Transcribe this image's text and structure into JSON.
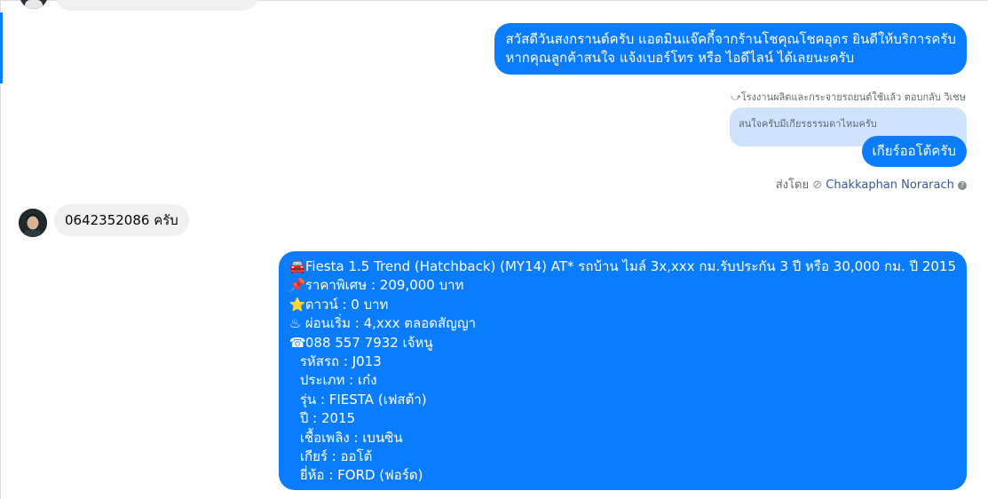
{
  "messages": {
    "top_outgoing": {
      "lines": [
        "สวัสดีวันสงกรานต์ครับ แอดมินแจ๊คกี้จากร้านโชคุณโชคอุดร ยินดีให้บริการครับ",
        "หากคุณลูกค้าสนใจ แจ้งเบอร์โทร หรือ ไอดีไลน์ ได้เลยนะครับ"
      ]
    },
    "reply_context": {
      "label": "โรงงานผลิตและกระจายรถยนต์ใช้แล้ว ตอบกลับ วิเชษ",
      "quoted_text": "สนใจครับมีเกียรธรรมดาไหมครับ"
    },
    "gear_reply": "เกียร์ออโต้ครับ",
    "sent_by": {
      "prefix": "ส่งโดย",
      "name": "Chakkaphan Norarach",
      "help": "?"
    },
    "incoming_phone": "0642352086  ครับ",
    "listing": {
      "lines": [
        {
          "icon": "🚘",
          "text": "Fiesta 1.5 Trend (Hatchback) (MY14) AT* รถบ้าน ไมล์ 3x,xxx กม.รับประกัน 3 ปี หรือ 30,000 กม. ปี 2015"
        },
        {
          "icon": "📌",
          "text": "ราคาพิเศษ : 209,000 บาท"
        },
        {
          "icon": "⭐",
          "text": "ดาวน์ : 0 บาท"
        },
        {
          "icon": "♨",
          "text": "ผ่อนเริ่ม : 4,xxx ตลอดสัญญา"
        },
        {
          "icon": "☎",
          "text": "088 557 7932 เจ้หนู"
        }
      ],
      "details": [
        "รหัสรถ : J013",
        "ประเภท : เก๋ง",
        "รุ่น : FIESTA (เฟสต้า)",
        "ปี : 2015",
        "เชื้อเพลิง : เบนซิน",
        "เกียร์ : ออโต้",
        "ยี่ห้อ : FORD (ฟอร์ด)"
      ]
    }
  }
}
